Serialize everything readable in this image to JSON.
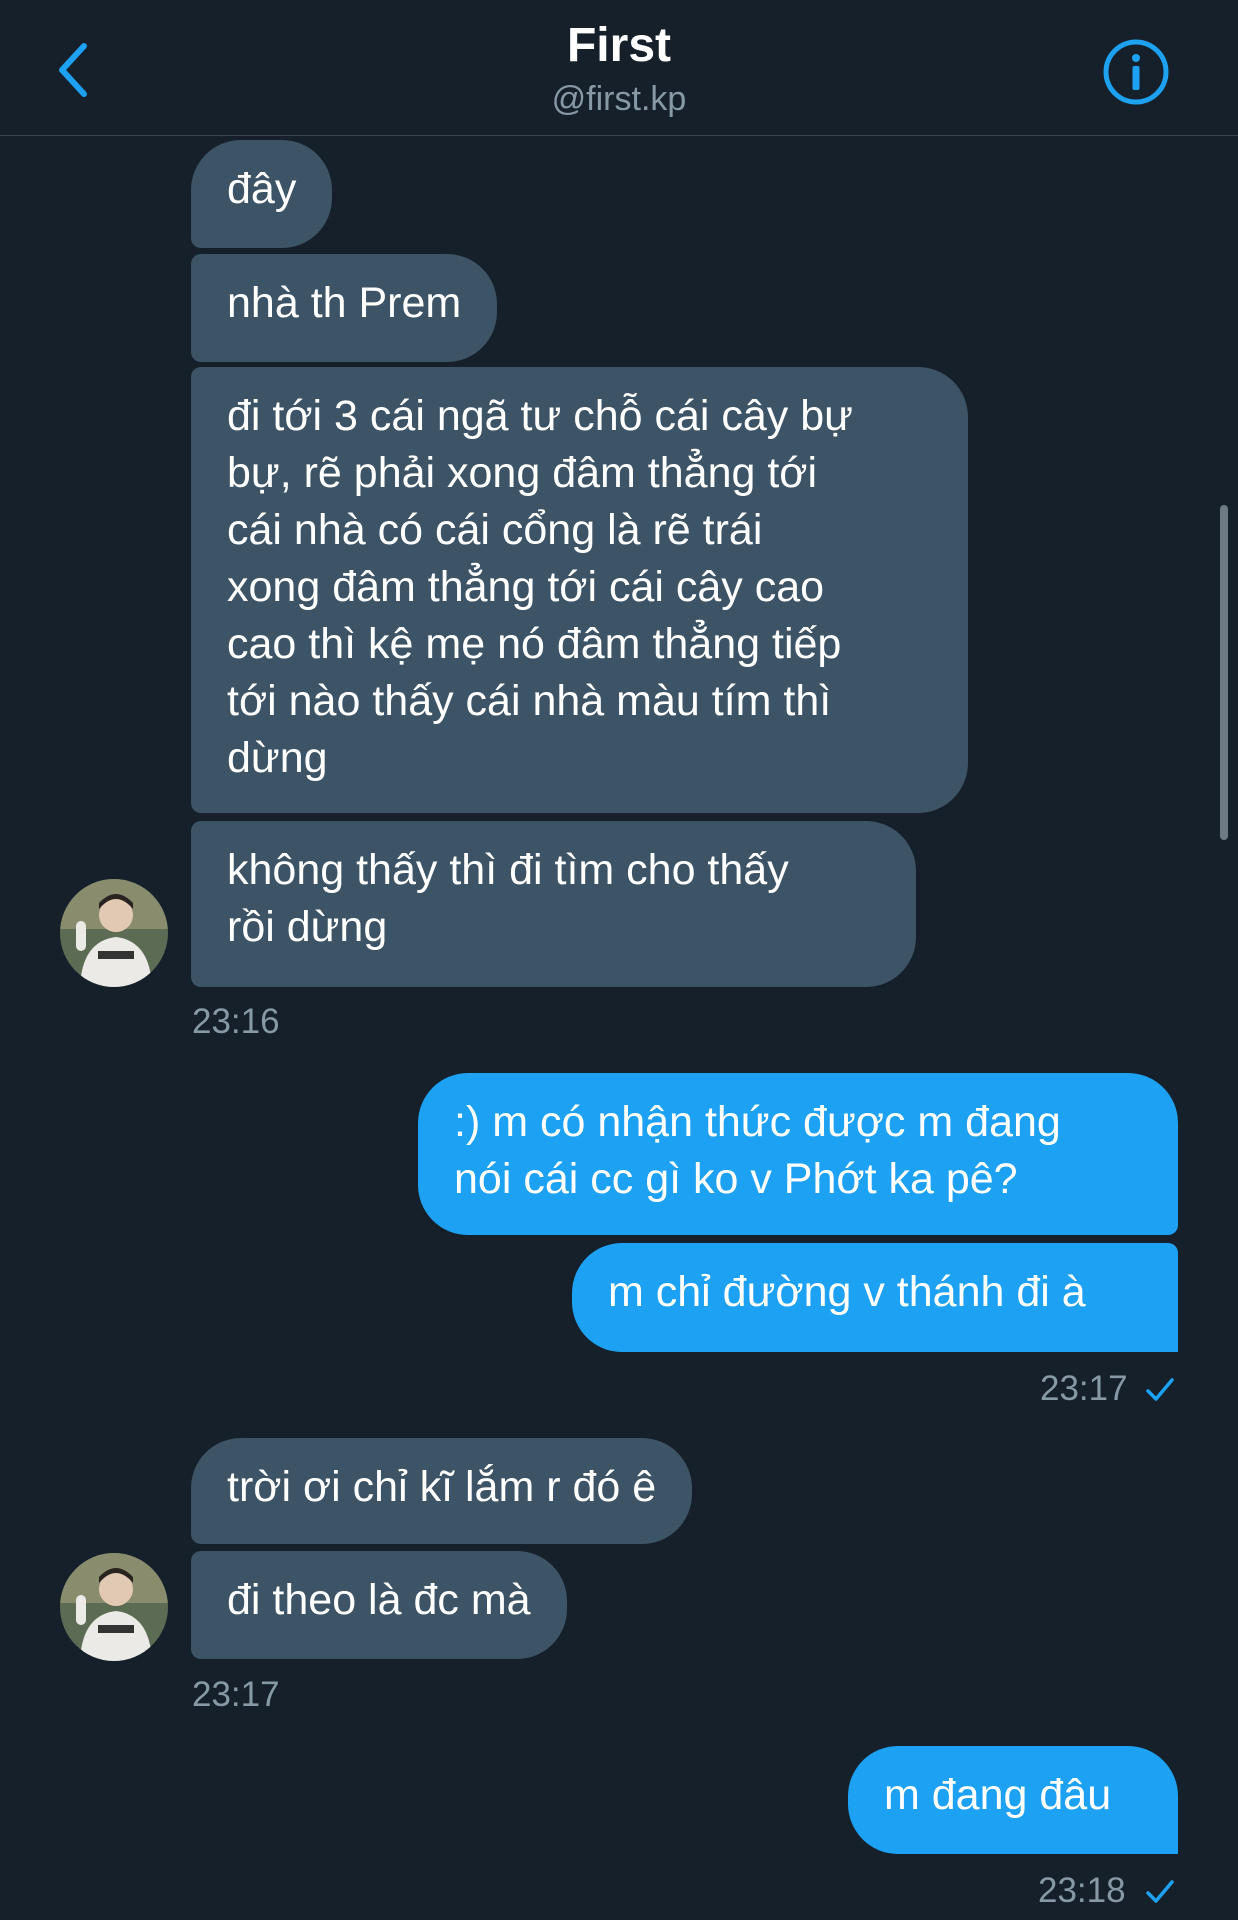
{
  "header": {
    "title": "First",
    "handle": "@first.kp",
    "back_icon": "chevron-left-icon",
    "info_icon": "info-circle-icon"
  },
  "colors": {
    "background": "#15202b",
    "incoming_bubble": "#3d5466",
    "outgoing_bubble": "#1da1f2",
    "accent": "#1da1f2",
    "muted_text": "#8899a6"
  },
  "messages": [
    {
      "direction": "in",
      "text": "đây"
    },
    {
      "direction": "in",
      "text": "nhà th Prem"
    },
    {
      "direction": "in",
      "text": "đi tới 3 cái ngã tư chỗ cái cây bự\nbự, rẽ phải xong đâm thẳng tới\ncái nhà có cái cổng là rẽ trái\nxong đâm thẳng tới cái cây cao\ncao thì kệ mẹ nó đâm thẳng tiếp\ntới nào thấy cái nhà màu tím thì\ndừng"
    },
    {
      "direction": "in",
      "text": "không thấy thì đi tìm cho thấy\nrồi dừng"
    },
    {
      "direction": "out",
      "text": ":) m có nhận thức được m đang\nnói cái cc gì ko v Phớt ka pê?"
    },
    {
      "direction": "out",
      "text": "m chỉ đường v thánh đi à"
    },
    {
      "direction": "in",
      "text": "trời ơi chỉ kĩ lắm r đó ê"
    },
    {
      "direction": "in",
      "text": "đi theo là đc mà"
    },
    {
      "direction": "out",
      "text": "m đang đâu"
    }
  ],
  "timestamps": [
    "23:16",
    "23:17",
    "23:17",
    "23:18"
  ],
  "read_receipt_icon": "checkmark-icon"
}
